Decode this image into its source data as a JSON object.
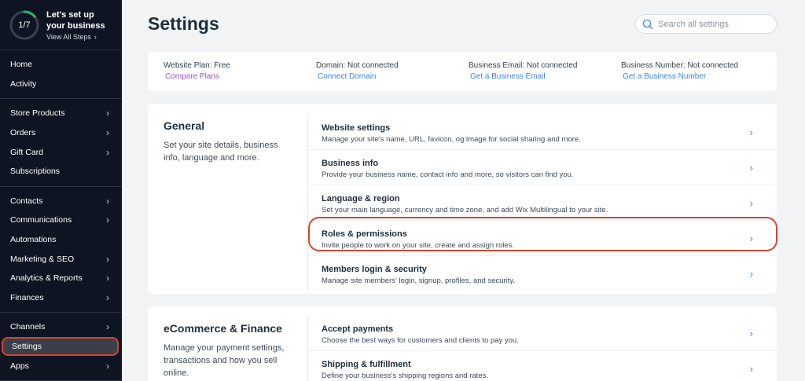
{
  "setup": {
    "progress_label": "1/7",
    "progress_fraction": 0.1429,
    "title": "Let's set up your business",
    "link": "View All Steps",
    "ring_color": "#2bb673"
  },
  "sidebar": {
    "groups": [
      [
        {
          "label": "Home",
          "chev": false
        },
        {
          "label": "Activity",
          "chev": false
        }
      ],
      [
        {
          "label": "Store Products",
          "chev": true
        },
        {
          "label": "Orders",
          "chev": true
        },
        {
          "label": "Gift Card",
          "chev": true
        },
        {
          "label": "Subscriptions",
          "chev": false
        }
      ],
      [
        {
          "label": "Contacts",
          "chev": true
        },
        {
          "label": "Communications",
          "chev": true
        },
        {
          "label": "Automations",
          "chev": false
        },
        {
          "label": "Marketing & SEO",
          "chev": true
        },
        {
          "label": "Analytics & Reports",
          "chev": true
        },
        {
          "label": "Finances",
          "chev": true
        }
      ],
      [
        {
          "label": "Channels",
          "chev": true
        },
        {
          "label": "Settings",
          "chev": false,
          "active": true
        },
        {
          "label": "Apps",
          "chev": true
        }
      ]
    ]
  },
  "header": {
    "title": "Settings",
    "search_placeholder": "Search all settings"
  },
  "info": [
    {
      "label": "Website Plan: Free",
      "link": "Compare Plans",
      "link_color": "purple"
    },
    {
      "label": "Domain: Not connected",
      "link": "Connect Domain",
      "link_color": "blue"
    },
    {
      "label": "Business Email: Not connected",
      "link": "Get a Business Email",
      "link_color": "blue"
    },
    {
      "label": "Business Number: Not connected",
      "link": "Get a Business Number",
      "link_color": "blue"
    }
  ],
  "general": {
    "heading": "General",
    "description": "Set your site details, business info, language and more.",
    "rows": [
      {
        "title": "Website settings",
        "desc": "Manage your site's name, URL, favicon, og:image for social sharing and more."
      },
      {
        "title": "Business info",
        "desc": "Provide your business name, contact info and more, so visitors can find you."
      },
      {
        "title": "Language & region",
        "desc": "Set your main language, currency and time zone, and add Wix Multilingual to your site."
      },
      {
        "title": "Roles & permissions",
        "desc": "Invite people to work on your site, create and assign roles."
      },
      {
        "title": "Members login & security",
        "desc": "Manage site members' login, signup, profiles, and security."
      }
    ]
  },
  "ecommerce": {
    "heading": "eCommerce & Finance",
    "description": "Manage your payment settings, transactions and how you sell online.",
    "rows": [
      {
        "title": "Accept payments",
        "desc": "Choose the best ways for customers and clients to pay you."
      },
      {
        "title": "Shipping & fulfillment",
        "desc": "Define your business's shipping regions and rates."
      }
    ]
  },
  "colors": {
    "sidebar_bg": "#0e1421",
    "highlight": "#d1462f",
    "link_blue": "#3b82f6",
    "link_purple": "#a552d4"
  }
}
